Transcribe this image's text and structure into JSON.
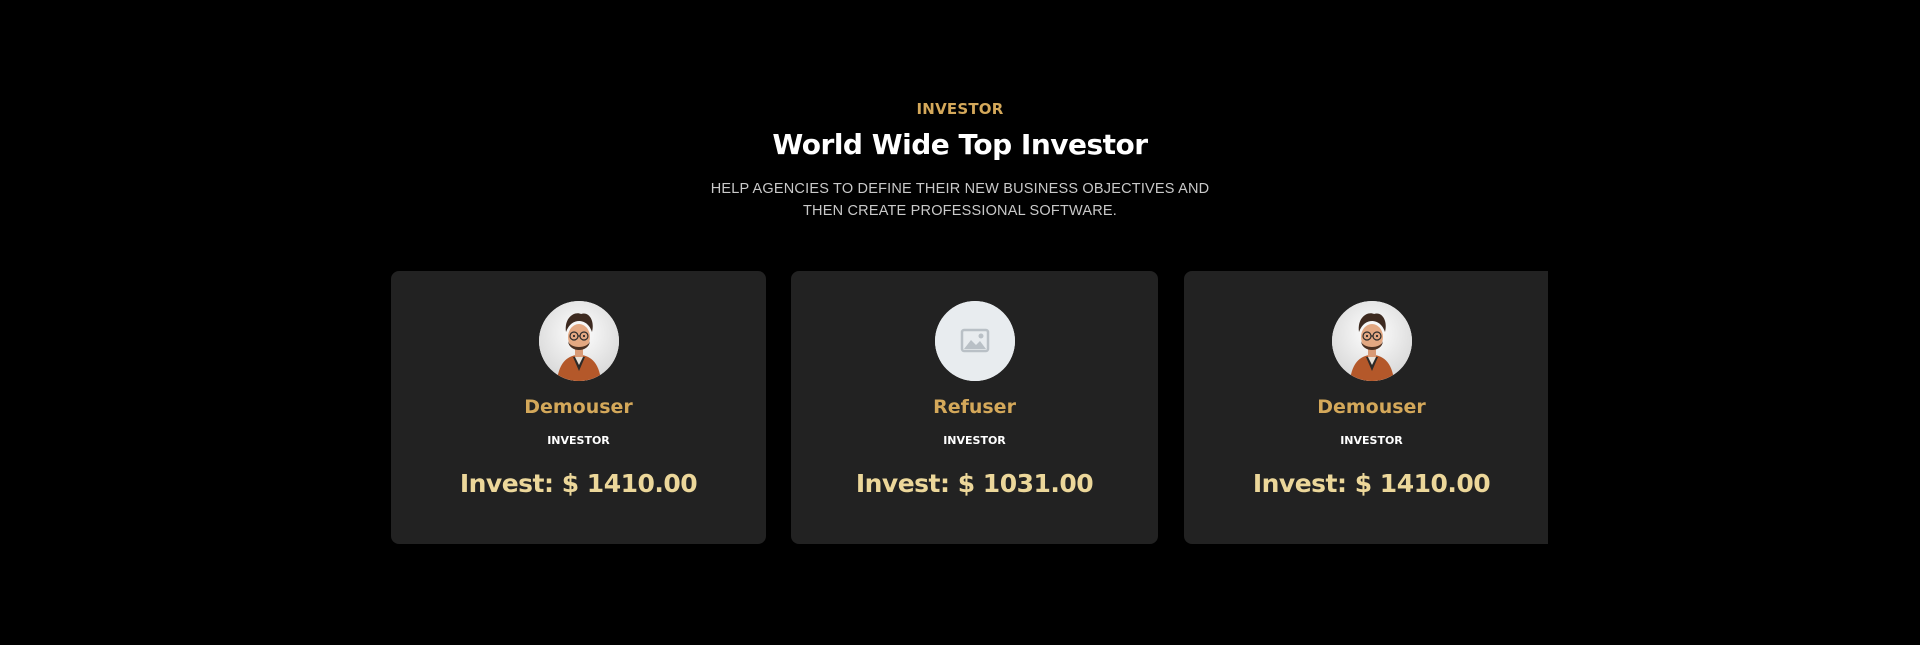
{
  "section": {
    "eyebrow": "INVESTOR",
    "title": "World Wide Top Investor",
    "subtitle": "HELP AGENCIES TO DEFINE THEIR NEW BUSINESS OBJECTIVES AND THEN CREATE PROFESSIONAL SOFTWARE."
  },
  "investors": [
    {
      "name": "Demouser",
      "role": "INVESTOR",
      "invest": "Invest: $ 1410.00",
      "avatar": "cartoon-man-avatar"
    },
    {
      "name": "Refuser",
      "role": "INVESTOR",
      "invest": "Invest: $ 1031.00",
      "avatar": "image-placeholder-icon"
    },
    {
      "name": "Demouser",
      "role": "INVESTOR",
      "invest": "Invest: $ 1410.00",
      "avatar": "cartoon-man-avatar"
    }
  ],
  "colors": {
    "background": "#000000",
    "card": "#222222",
    "accent": "#d4a85a",
    "invest": "#ecd79a"
  }
}
